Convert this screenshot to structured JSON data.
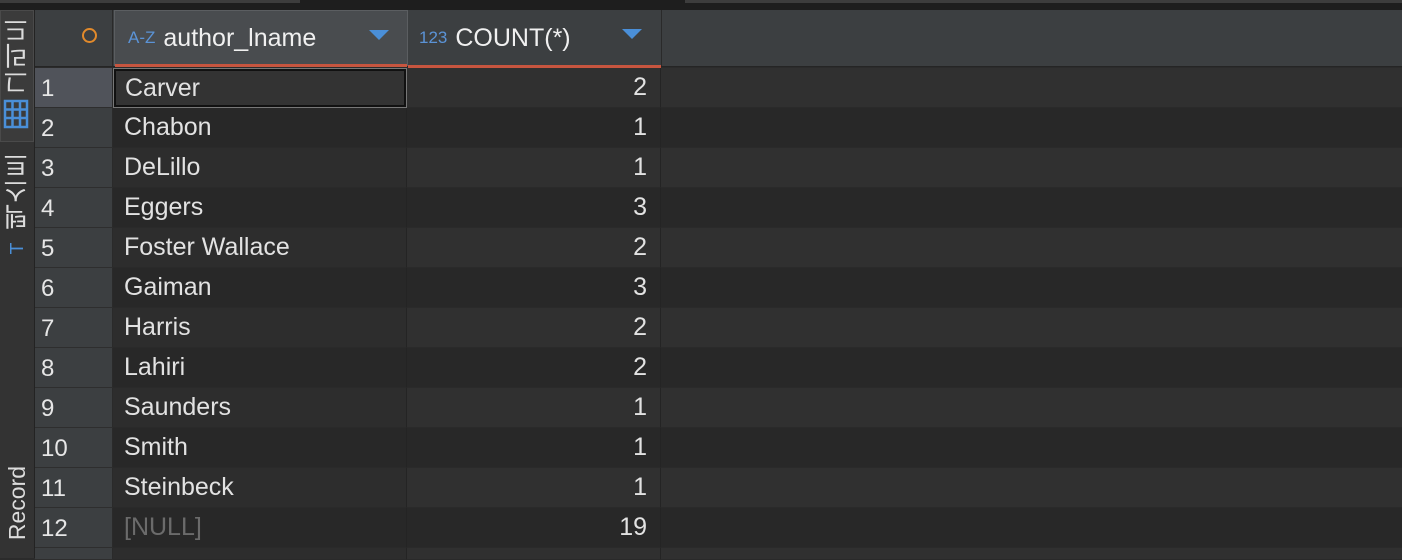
{
  "sidebar": {
    "tabs": [
      {
        "label": "그리드",
        "icon": "grid-icon",
        "active": true
      },
      {
        "label": "텍스트",
        "icon": "text-icon",
        "active": false
      },
      {
        "label": "Record",
        "icon": "",
        "active": false
      }
    ]
  },
  "table": {
    "columns": [
      {
        "type_icon": "A-Z",
        "name": "author_lname"
      },
      {
        "type_icon": "123",
        "name": "COUNT(*)"
      }
    ],
    "rows": [
      {
        "num": "1",
        "author_lname": "Carver",
        "count": "2"
      },
      {
        "num": "2",
        "author_lname": "Chabon",
        "count": "1"
      },
      {
        "num": "3",
        "author_lname": "DeLillo",
        "count": "1"
      },
      {
        "num": "4",
        "author_lname": "Eggers",
        "count": "3"
      },
      {
        "num": "5",
        "author_lname": "Foster Wallace",
        "count": "2"
      },
      {
        "num": "6",
        "author_lname": "Gaiman",
        "count": "3"
      },
      {
        "num": "7",
        "author_lname": "Harris",
        "count": "2"
      },
      {
        "num": "8",
        "author_lname": "Lahiri",
        "count": "2"
      },
      {
        "num": "9",
        "author_lname": "Saunders",
        "count": "1"
      },
      {
        "num": "10",
        "author_lname": "Smith",
        "count": "1"
      },
      {
        "num": "11",
        "author_lname": "Steinbeck",
        "count": "1"
      },
      {
        "num": "12",
        "author_lname": "[NULL]",
        "count": "19"
      }
    ]
  },
  "colors": {
    "accent_blue": "#4a8fd8",
    "header_underline": "#c7553f",
    "corner_circle": "#e28a2b"
  }
}
